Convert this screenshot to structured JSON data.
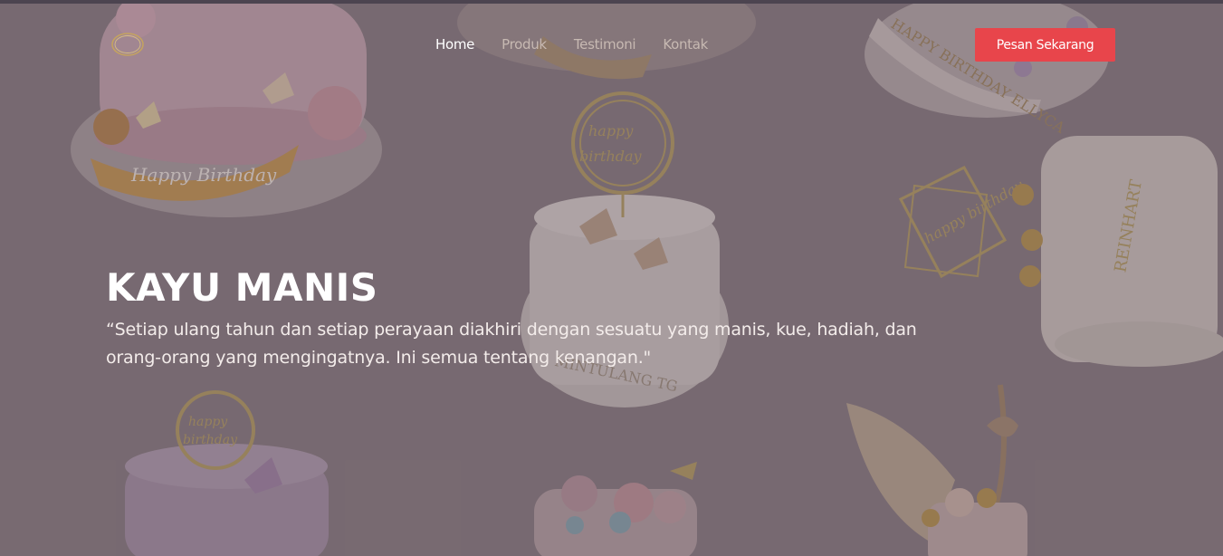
{
  "navbar": {
    "logo_icon": "logo-ring-icon",
    "links": [
      {
        "label": "Home",
        "active": true
      },
      {
        "label": "Produk",
        "active": false
      },
      {
        "label": "Testimoni",
        "active": false
      },
      {
        "label": "Kontak",
        "active": false
      }
    ],
    "cta_label": "Pesan Sekarang"
  },
  "hero": {
    "title": "KAYU MANIS",
    "quote": "“Setiap ulang tahun dan setiap perayaan diakhiri dengan sesuatu yang manis, kue, hadiah, dan orang-orang yang mengingatnya. Ini semua tentang kenangan.\""
  },
  "colors": {
    "background": "#7d6e74",
    "cta": "#e8454b",
    "nav_active": "#ffffff",
    "nav_inactive": "#c7b9b2"
  }
}
